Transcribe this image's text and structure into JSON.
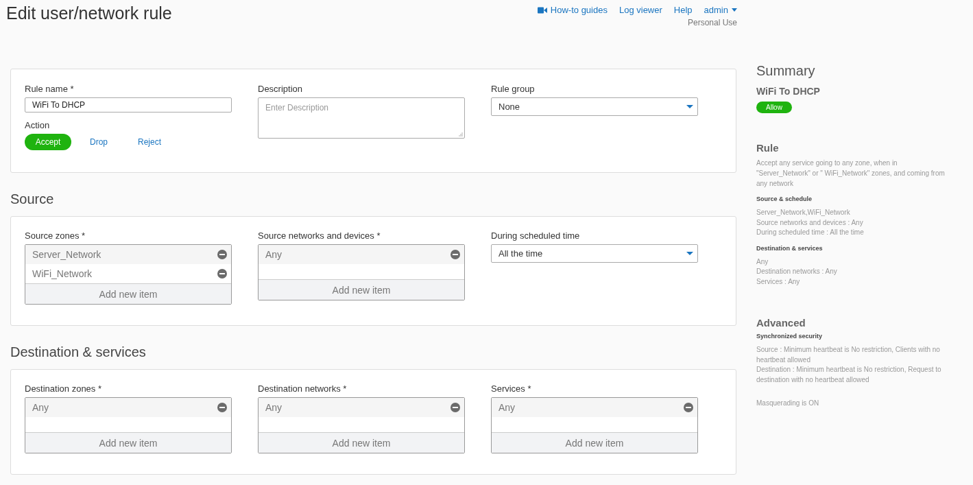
{
  "page": {
    "title": "Edit user/network rule"
  },
  "top_nav": {
    "links": [
      {
        "label": "How-to guides",
        "kind": "video"
      },
      {
        "label": "Log viewer",
        "kind": "plain"
      },
      {
        "label": "Help",
        "kind": "plain"
      },
      {
        "label": "admin",
        "kind": "menu"
      }
    ],
    "subtitle": "Personal Use"
  },
  "general": {
    "rule_name": {
      "label": "Rule name *",
      "value": "WiFi To DHCP"
    },
    "action": {
      "label": "Action",
      "options": [
        {
          "label": "Accept",
          "selected": true
        },
        {
          "label": "Drop",
          "selected": false
        },
        {
          "label": "Reject",
          "selected": false
        }
      ]
    },
    "description": {
      "label": "Description",
      "placeholder": "Enter Description"
    },
    "rule_group": {
      "label": "Rule group",
      "value": "None"
    }
  },
  "sections": [
    {
      "title": "Source",
      "fields": [
        {
          "kind": "list",
          "label": "Source zones *",
          "items": [
            "Server_Network",
            "WiFi_Network"
          ],
          "add_label": "Add new item"
        },
        {
          "kind": "list",
          "label": "Source networks and devices *",
          "items": [
            "Any"
          ],
          "add_label": "Add new item"
        },
        {
          "kind": "select",
          "label": "During scheduled time",
          "value": "All the time"
        }
      ]
    },
    {
      "title": "Destination & services",
      "fields": [
        {
          "kind": "list",
          "label": "Destination zones *",
          "items": [
            "Any"
          ],
          "add_label": "Add new item"
        },
        {
          "kind": "list",
          "label": "Destination networks *",
          "items": [
            "Any"
          ],
          "add_label": "Add new item"
        },
        {
          "kind": "list",
          "label": "Services *",
          "items": [
            "Any"
          ],
          "add_label": "Add new item"
        }
      ]
    }
  ],
  "summary": {
    "title": "Summary",
    "rule_name": "WiFi To DHCP",
    "badge": "Allow",
    "rule": {
      "title": "Rule",
      "text": "Accept any service going to any zone, when in \"Server_Network\" or \" WiFi_Network\" zones, and coming from any network",
      "groups": [
        {
          "heading": "Source & schedule",
          "lines": [
            "Server_Network,WiFi_Network",
            "Source networks and devices : Any",
            "During scheduled time : All the time"
          ]
        },
        {
          "heading": "Destination & services",
          "lines": [
            "Any",
            "Destination networks : Any",
            "Services : Any"
          ]
        }
      ]
    },
    "advanced": {
      "title": "Advanced",
      "heading": "Synchronized security",
      "lines": [
        "Source : Minimum heartbeat is No restriction, Clients with no heartbeat allowed",
        "Destination : Minimum heartbeat is No restriction, Request to destination with no heartbeat allowed"
      ],
      "note": "Masquerading is ON"
    }
  }
}
